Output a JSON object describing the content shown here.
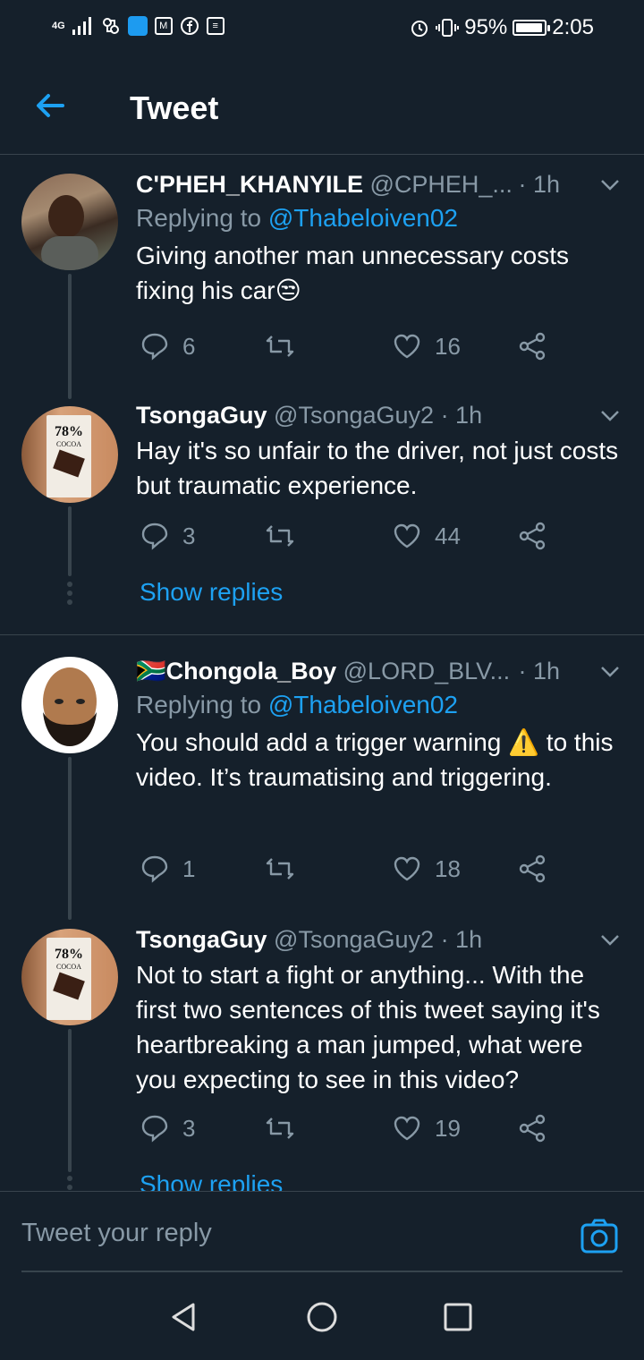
{
  "status_bar": {
    "network": "4G",
    "battery": "95%",
    "battery_level": 0.95,
    "time": "2:05"
  },
  "header": {
    "title": "Tweet"
  },
  "tweets": [
    {
      "name": "C'PHEH_KHANYILE",
      "handle": "@CPHEH_...",
      "time": "· 1h",
      "replying_prefix": "Replying to ",
      "replying_to": "@Thabeloiven02",
      "text": "Giving another man unnecessary costs fixing his car😒",
      "replies": "6",
      "retweets": "",
      "likes": "16"
    },
    {
      "name": "TsongaGuy",
      "handle": "@TsongaGuy2",
      "time": "· 1h",
      "text": "Hay it's so unfair to the driver,  not just costs but traumatic experience.",
      "replies": "3",
      "retweets": "",
      "likes": "44",
      "show_replies": "Show replies",
      "avatar_label": "78%",
      "avatar_sub": "COCOA"
    },
    {
      "name": "🇿🇦Chongola_Boy",
      "handle": "@LORD_BLV...",
      "time": "· 1h",
      "replying_prefix": "Replying to ",
      "replying_to": "@Thabeloiven02",
      "text": "You should add a trigger warning ⚠️ to this video. It’s traumatising and triggering.",
      "replies": "1",
      "retweets": "",
      "likes": "18"
    },
    {
      "name": "TsongaGuy",
      "handle": "@TsongaGuy2",
      "time": "· 1h",
      "text": "Not to start a fight or anything... With the first two sentences of this tweet saying it's heartbreaking a man jumped, what were you expecting to see in this video?",
      "replies": "3",
      "retweets": "",
      "likes": "19",
      "show_replies": "Show replies",
      "avatar_label": "78%",
      "avatar_sub": "COCOA"
    }
  ],
  "reply_bar": {
    "placeholder": "Tweet your reply"
  },
  "colors": {
    "background": "#15202b",
    "accent": "#1da1f2",
    "muted": "#8899a6",
    "border": "#38444d"
  },
  "icons": [
    "back-arrow-icon",
    "chevron-down-icon",
    "reply-icon",
    "retweet-icon",
    "like-icon",
    "share-icon",
    "camera-icon",
    "nav-back-icon",
    "nav-home-icon",
    "nav-recents-icon"
  ]
}
